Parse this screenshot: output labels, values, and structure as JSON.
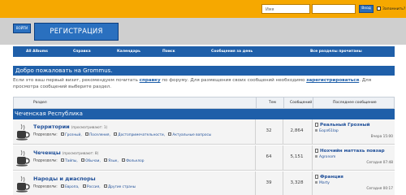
{
  "login": {
    "username_placeholder": "Имя",
    "submit_label": "Вход",
    "remember_label": "Запомнить?"
  },
  "header": {
    "login_button": "ВОЙТИ",
    "register_button": "РЕГИСТРАЦИЯ"
  },
  "nav": {
    "items": [
      "All Albums",
      "Справка",
      "Календарь",
      "Поиск",
      "Сообщения за день",
      "Все разделы прочитаны"
    ]
  },
  "welcome": {
    "title": "Добро пожаловать на Grommus.",
    "text_before_help": "Если это ваш первый визит, рекомендуем почитать",
    "help_link": "справку",
    "text_mid": "по форуму. Для размещения своих сообщений необходимо",
    "register_link": "зарегистрироваться",
    "text_after": ". Для просмотра сообщений выберите раздел."
  },
  "table": {
    "col_section": "Раздел",
    "col_topics": "Тем",
    "col_posts": "Сообщений",
    "col_last": "Последнее сообщение",
    "category": "Чеченская Республика",
    "rows": [
      {
        "title": "Территории",
        "viewing": "(просматривают: 1)",
        "subforums_label": "Подразделы:",
        "subforums": [
          "Грозный",
          "Поселения",
          "Достопримечательности",
          "Актуальные вопросы"
        ],
        "topics": "32",
        "posts": "2,864",
        "last_title": "Реальный Грозный",
        "last_author": "Борз61Iар",
        "last_time": "Вчера 15:00"
      },
      {
        "title": "Чеченцы",
        "viewing": "(просматривают: 8)",
        "subforums_label": "Подразделы:",
        "subforums": [
          "Тайпы",
          "Обычаи",
          "Язык",
          "Фольклор"
        ],
        "topics": "64",
        "posts": "5,151",
        "last_title": "Нохчийн маттахь повзар",
        "last_author": "Agronom",
        "last_time": "Сегодня 07:48"
      },
      {
        "title": "Народы и диаспоры",
        "viewing": "",
        "subforums_label": "Подразделы:",
        "subforums": [
          "Европа",
          "Россия",
          "Другие страны"
        ],
        "topics": "39",
        "posts": "3,328",
        "last_title": "Франция",
        "last_author": "Marty",
        "last_time": "Сегодня 00:17"
      }
    ]
  }
}
